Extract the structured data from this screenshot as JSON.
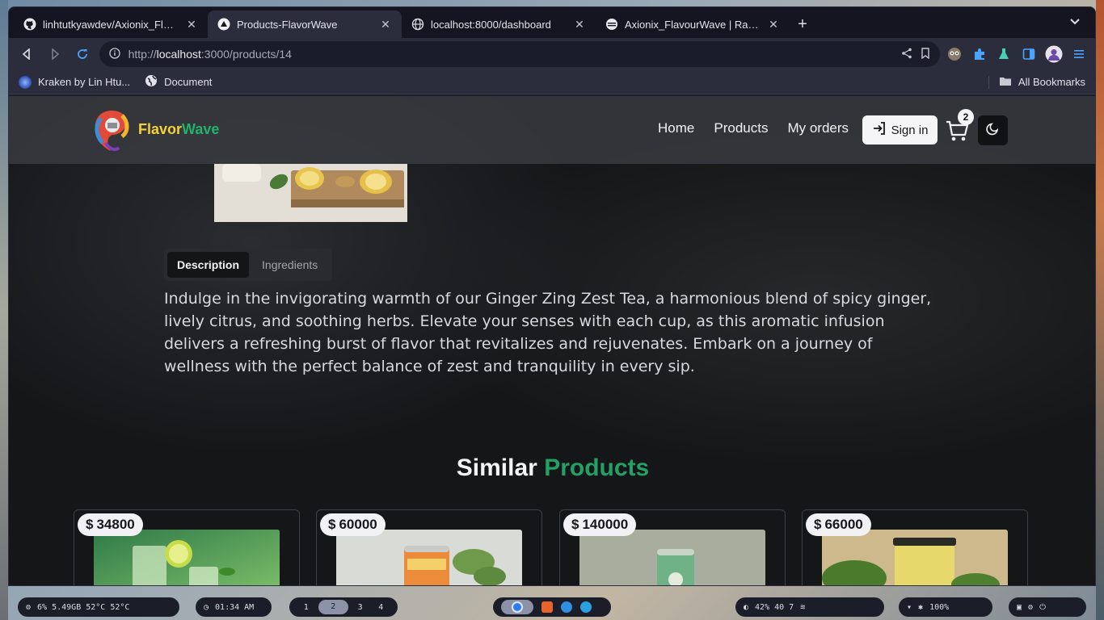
{
  "browser": {
    "tabs": [
      {
        "title": "linhtutkyawdev/Axionix_Flavo",
        "icon": "github-icon",
        "active": false
      },
      {
        "title": "Products-FlavorWave",
        "icon": "triangle-icon",
        "active": true
      },
      {
        "title": "localhost:8000/dashboard",
        "icon": "globe-icon",
        "active": false
      },
      {
        "title": "Axionix_FlavourWave | Railwa",
        "icon": "railway-icon",
        "active": false
      }
    ],
    "url_prefix": "http://",
    "url_host": "localhost",
    "url_path": ":3000/products/14",
    "bookmarks": [
      {
        "label": "Kraken by Lin Htu...",
        "icon": "kraken-icon"
      },
      {
        "label": "Document",
        "icon": "globe-icon"
      }
    ],
    "all_bookmarks": "All Bookmarks"
  },
  "site": {
    "brand_part1": "Flavor",
    "brand_part2": "Wave",
    "nav": [
      "Home",
      "Products",
      "My orders"
    ],
    "signin_label": "Sign in",
    "cart_count": "2",
    "tabs": {
      "description": "Description",
      "ingredients": "Ingredients"
    },
    "description": "Indulge in the invigorating warmth of our Ginger Zing Zest Tea, a harmonious blend of spicy ginger, lively citrus, and soothing herbs. Elevate your senses with each cup, as this aromatic infusion delivers a refreshing burst of flavor that revitalizes and rejuvenates. Embark on a journey of wellness with the perfect balance of zest and tranquility in every sip.",
    "similar_title_part1": "Similar",
    "similar_title_part2": "Products",
    "currency": "$",
    "similar_products": [
      {
        "price": "34800"
      },
      {
        "price": "60000"
      },
      {
        "price": "140000"
      },
      {
        "price": "66000"
      }
    ],
    "colors": {
      "brand_yellow": "#f5d23a",
      "brand_green": "#23b26d",
      "accent_green": "#23a065"
    }
  },
  "taskbar": {
    "system_stats": "6%  5.49GB  52°C  52°C",
    "clock": "01:34 AM",
    "workspaces": [
      "1",
      "2",
      "3",
      "4"
    ],
    "active_workspace": "2",
    "status": "42%   40   7",
    "battery": "100%"
  }
}
